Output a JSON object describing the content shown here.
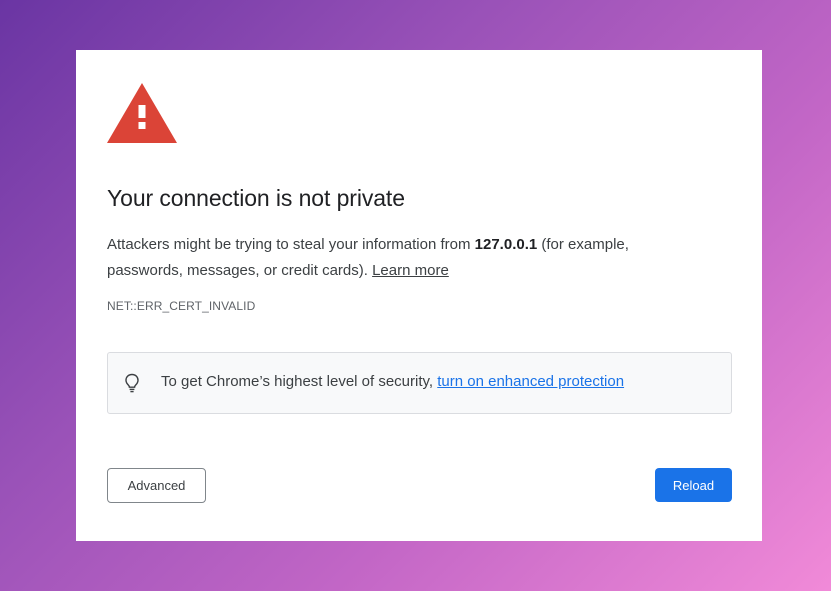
{
  "page": {
    "title": "Your connection is not private",
    "message_before": "Attackers might be trying to steal your information from ",
    "host": "127.0.0.1",
    "message_after": " (for example, passwords, messages, or credit cards). ",
    "learn_more": "Learn more",
    "error_code": "NET::ERR_CERT_INVALID"
  },
  "security_tip": {
    "icon": "lightbulb-icon",
    "text": "To get Chrome’s highest level of security, ",
    "link": "turn on enhanced protection"
  },
  "buttons": {
    "advanced": "Advanced",
    "reload": "Reload"
  },
  "icons": {
    "warning": "warning-triangle-icon"
  },
  "colors": {
    "warning_red": "#d93025",
    "link_blue": "#1a73e8",
    "primary_button": "#1a73e8",
    "card_background": "#ffffff"
  }
}
